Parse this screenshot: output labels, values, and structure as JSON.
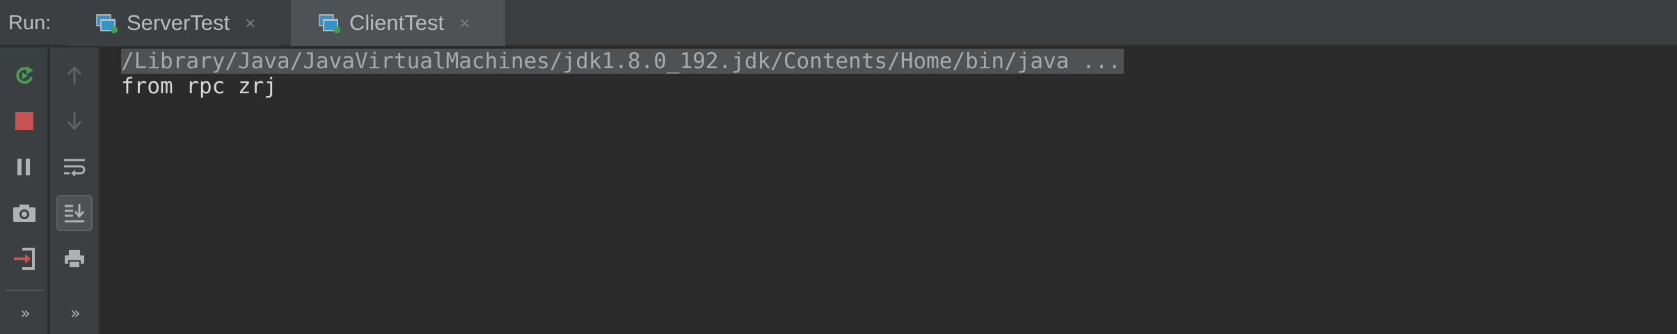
{
  "run_panel": {
    "label": "Run:",
    "tabs": [
      {
        "label": "ServerTest",
        "close": "×",
        "active": false
      },
      {
        "label": "ClientTest",
        "close": "×",
        "active": true
      }
    ]
  },
  "toolbar": {
    "primary": [
      {
        "name": "rerun",
        "icon": "rerun-icon",
        "color": "#499c54"
      },
      {
        "name": "stop",
        "icon": "stop-icon",
        "color": "#c75450"
      },
      {
        "name": "pause",
        "icon": "pause-icon"
      },
      {
        "name": "screenshot",
        "icon": "camera-icon"
      },
      {
        "name": "exit",
        "icon": "exit-icon",
        "color": "#c75450"
      },
      {
        "name": "more",
        "icon": "chevrons-icon",
        "label": "»"
      }
    ],
    "secondary": [
      {
        "name": "up",
        "icon": "arrow-up-icon"
      },
      {
        "name": "down",
        "icon": "arrow-down-icon"
      },
      {
        "name": "soft-wrap",
        "icon": "soft-wrap-icon"
      },
      {
        "name": "scroll-to-end",
        "icon": "scroll-to-end-icon",
        "active": true
      },
      {
        "name": "print",
        "icon": "print-icon"
      },
      {
        "name": "more",
        "icon": "chevrons-icon",
        "label": "»"
      }
    ]
  },
  "console": {
    "lines": [
      "/Library/Java/JavaVirtualMachines/jdk1.8.0_192.jdk/Contents/Home/bin/java ...",
      "from rpc zrj"
    ]
  },
  "colors": {
    "background": "#2b2b2b",
    "panel": "#3c3f41",
    "active_tab": "#4e5254",
    "text": "#bbbbbb",
    "green": "#499c54",
    "red": "#c75450",
    "blue": "#3592c4"
  }
}
